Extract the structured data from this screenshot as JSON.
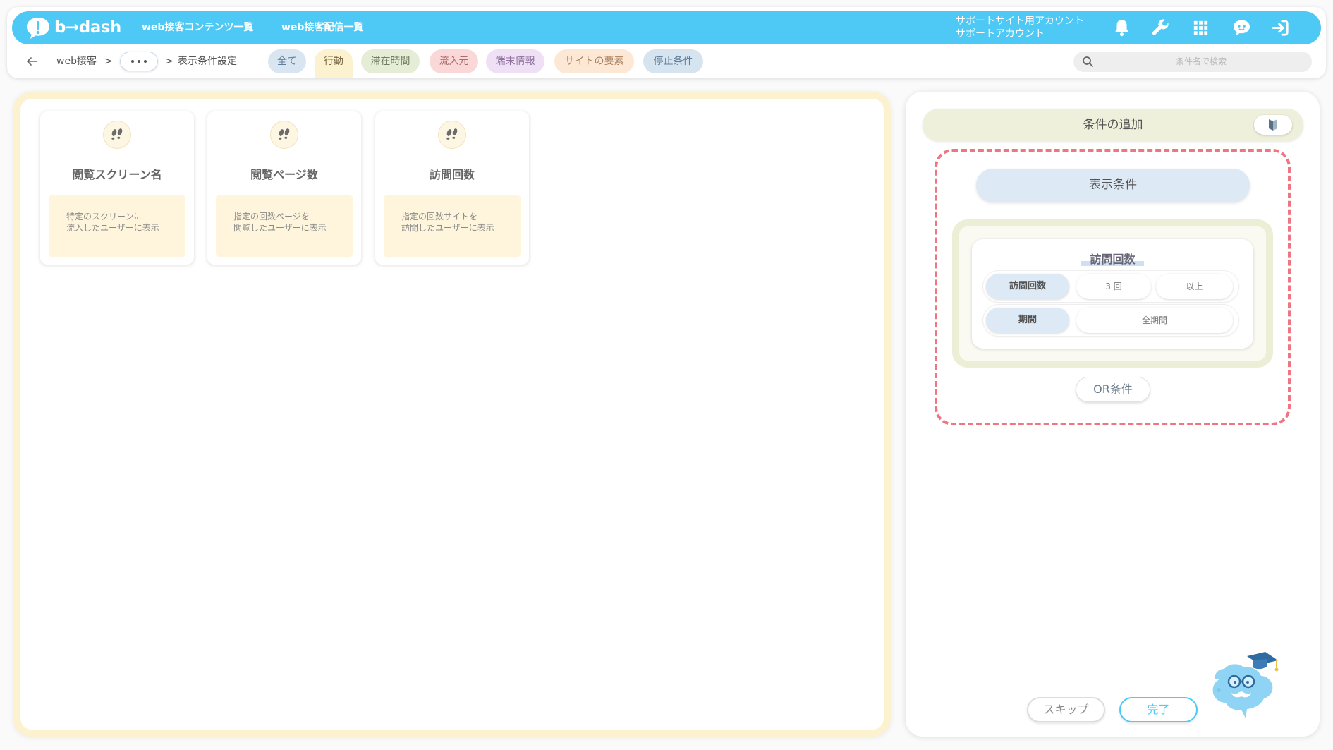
{
  "colors": {
    "brand_blue": "#4ec8f4",
    "active_tab": "#fdf2cf",
    "dashed_border": "#f07582",
    "panel_olive": "#eef0dc",
    "label_blue": "#dde9f5"
  },
  "header": {
    "logo_text": "b→dash",
    "logo_icon": "bdash-logo-icon",
    "nav": [
      {
        "label": "web接客コンテンツ一覧"
      },
      {
        "label": "web接客配信一覧"
      }
    ],
    "account": {
      "line1": "サポートサイト用アカウント",
      "line2": "サポートアカウント"
    },
    "icons": [
      "bell-icon",
      "wrench-icon",
      "grid-icon",
      "chat-icon",
      "logout-icon"
    ]
  },
  "breadcrumb": {
    "back_icon": "arrow-left-icon",
    "root": "web接客",
    "separator": ">",
    "more_icon": "more-horizontal-icon",
    "current": "表示条件設定"
  },
  "tabs": [
    {
      "label": "全て",
      "bg": "#d9e6f2",
      "fg": "#5f7e9d"
    },
    {
      "label": "行動",
      "bg": "#fdf2cf",
      "fg": "#7a6c45"
    },
    {
      "label": "滞在時間",
      "bg": "#e5edd6",
      "fg": "#6f7d60"
    },
    {
      "label": "流入元",
      "bg": "#fbd8d8",
      "fg": "#a86c6c"
    },
    {
      "label": "端末情報",
      "bg": "#efe0f5",
      "fg": "#8d6f9c"
    },
    {
      "label": "サイトの要素",
      "bg": "#fde8d6",
      "fg": "#a8805f"
    },
    {
      "label": "停止条件",
      "bg": "#d6e4f0",
      "fg": "#5f7e9d"
    }
  ],
  "active_tab": "行動",
  "search": {
    "placeholder": "条件名で検索",
    "icon": "search-icon"
  },
  "condition_cards": [
    {
      "title": "閲覧スクリーン名",
      "desc_line1": "特定のスクリーンに",
      "desc_line2": "流入したユーザーに表示",
      "icon": "footprints-icon"
    },
    {
      "title": "閲覧ページ数",
      "desc_line1": "指定の回数ページを",
      "desc_line2": "閲覧したユーザーに表示",
      "icon": "footprints-icon"
    },
    {
      "title": "訪問回数",
      "desc_line1": "指定の回数サイトを",
      "desc_line2": "訪問したユーザーに表示",
      "icon": "footprints-icon"
    }
  ],
  "side_panel": {
    "add_title": "条件の追加",
    "toggle_icon": "beginner-mark-icon",
    "display_condition": "表示条件",
    "condition": {
      "title": "訪問回数",
      "rows": [
        {
          "label": "訪問回数",
          "value": "3 回",
          "operator": "以上"
        },
        {
          "label": "期間",
          "value": "全期間"
        }
      ]
    },
    "or_button": "OR条件",
    "skip_button": "スキップ",
    "done_button": "完了",
    "mascot_icon": "mascot-icon"
  }
}
